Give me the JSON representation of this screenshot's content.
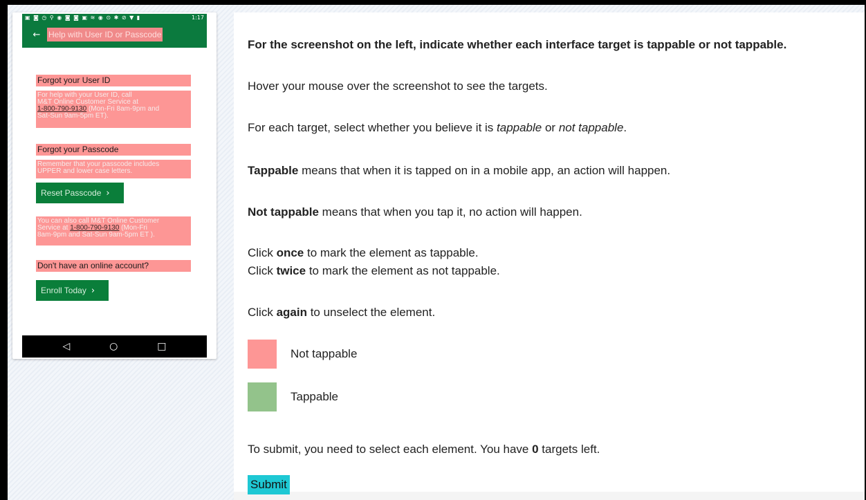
{
  "phone": {
    "status_icons": "▣ ◙ ◷ ⚲ ◉ ◙ ◙ ▣ ≋ ◉ ⊙ ✱ ⊘ ▼ ▮",
    "status_time": "1:17",
    "back_icon": "←",
    "appbar_title": "Help with User ID or Passcode",
    "forgot_user_id": "Forgot your User ID",
    "user_id_help_1": "For help with your User ID, call",
    "user_id_help_2": "M&T Online Customer Service at",
    "user_id_phone": "1-800-790-9130",
    "user_id_help_3": " (Mon-Fri 8am-9pm and",
    "user_id_help_4": "Sat-Sun 9am-5pm ET).",
    "forgot_passcode": "Forgot your Passcode",
    "passcode_help_1": "Remember that your passcode includes",
    "passcode_help_2": "UPPER and lower case letters.",
    "reset_button": "Reset Passcode",
    "chevron": "›",
    "also_call_1": "You can also call M&T Online Customer",
    "also_call_2a": "Service at ",
    "also_call_phone": "1-800-790-9130",
    "also_call_2b": " (Mon-Fri",
    "also_call_3": "8am-9pm and Sat-Sun 9am-5pm ET ).",
    "no_account": "Don't have an online account?",
    "enroll_button": "Enroll Today",
    "nav_back": "◁",
    "nav_home": "○",
    "nav_recent": "□"
  },
  "panel": {
    "title": "For the screenshot on the left, indicate whether each interface target is tappable or not tappable.",
    "hover": "Hover your mouse over the screenshot to see the targets.",
    "select_pre": "For each target, select whether you believe it is ",
    "select_tappable": "tappable",
    "select_or": " or ",
    "select_not": "not tappable",
    "select_end": ".",
    "tappable_bold": "Tappable",
    "tappable_rest": " means that when it is tapped on in a mobile app, an action will happen.",
    "not_tappable_bold": "Not tappable",
    "not_tappable_rest": " means that when you tap it, no action will happen.",
    "click_once_pre": "Click ",
    "click_once_bold": "once",
    "click_once_rest": " to mark the element as tappable.",
    "click_twice_pre": "Click ",
    "click_twice_bold": "twice",
    "click_twice_rest": " to mark the element as not tappable.",
    "click_again_pre": "Click ",
    "click_again_bold": "again",
    "click_again_rest": " to unselect the element.",
    "legend_not_tappable": "Not tappable",
    "legend_tappable": "Tappable",
    "submit_pre": "To submit, you need to select each element. You have ",
    "targets_left": "0",
    "submit_post": " targets left.",
    "submit_button": "Submit"
  },
  "colors": {
    "not_tappable": "#fd9695",
    "tappable": "#93c38b",
    "app_green": "#0b7a3e",
    "submit": "#1ec8d4"
  }
}
